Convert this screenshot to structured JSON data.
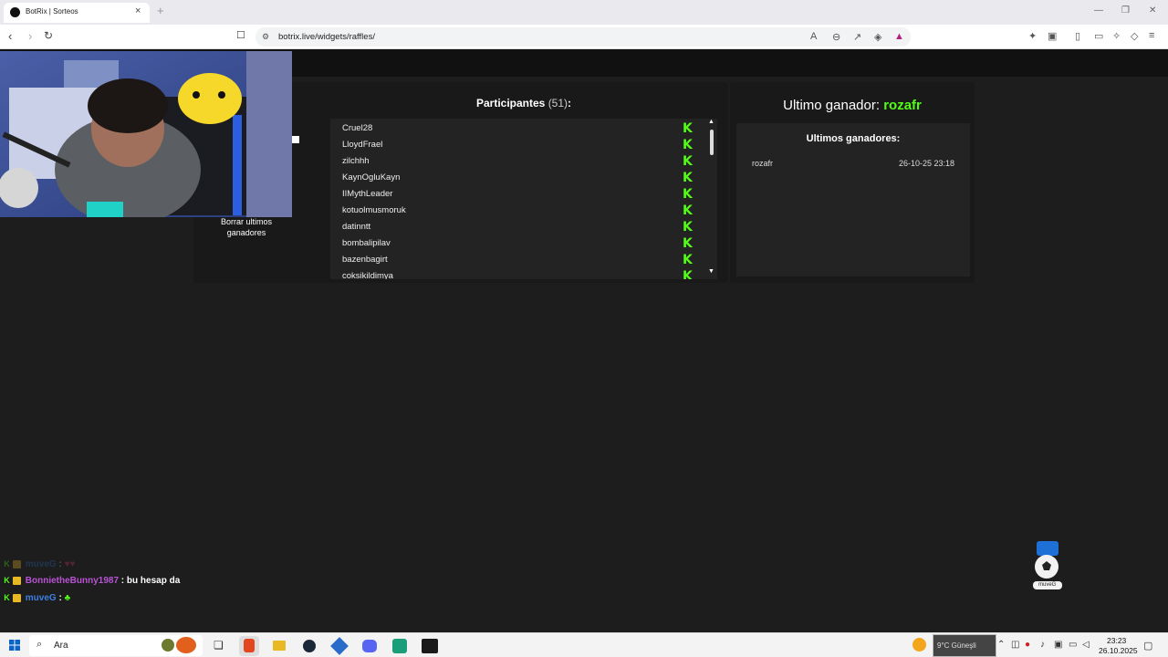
{
  "browser": {
    "tab_title": "BotRix | Sorteos",
    "tab_close": "×",
    "new_tab": "+",
    "url": "botrix.live/widgets/raffles/",
    "window_controls": {
      "minimize": "—",
      "maximize": "❐",
      "close": "✕"
    }
  },
  "participants": {
    "title": "Participantes",
    "count": "(51)",
    "colon": ":",
    "items": [
      "Cruel28",
      "LloydFrael",
      "zilchhh",
      "KaynOgluKayn",
      "IIMythLeader",
      "kotuolmusmoruk",
      "datinntt",
      "bombalipilav",
      "bazenbagirt",
      "coksikildimya"
    ],
    "platform_icon": "kick-icon"
  },
  "clear_button": "Borrar ultimos ganadores",
  "winner": {
    "label": "Ultimo ganador:",
    "name": "rozafr",
    "history_title": "Ultimos ganadores:",
    "history": [
      {
        "name": "rozafr",
        "date": "26-10-25 23:18"
      }
    ]
  },
  "chat": [
    {
      "user": "muveG",
      "text": "",
      "user_color": "#2a6cc9"
    },
    {
      "user": "BonnietheBunny1987",
      "text": "bu hesap da",
      "user_color": "#b854d4"
    },
    {
      "user": "muveG",
      "text": "",
      "user_color": "#2a6cc9"
    }
  ],
  "ball_widget_label": "muveG",
  "taskbar": {
    "search_placeholder": "Ara",
    "weather": "9°C  Güneşli",
    "time": "23:23",
    "date": "26.10.2025"
  },
  "colors": {
    "accent": "#53fc18",
    "page_bg": "#1d1d1d",
    "panel_bg": "#191919"
  }
}
